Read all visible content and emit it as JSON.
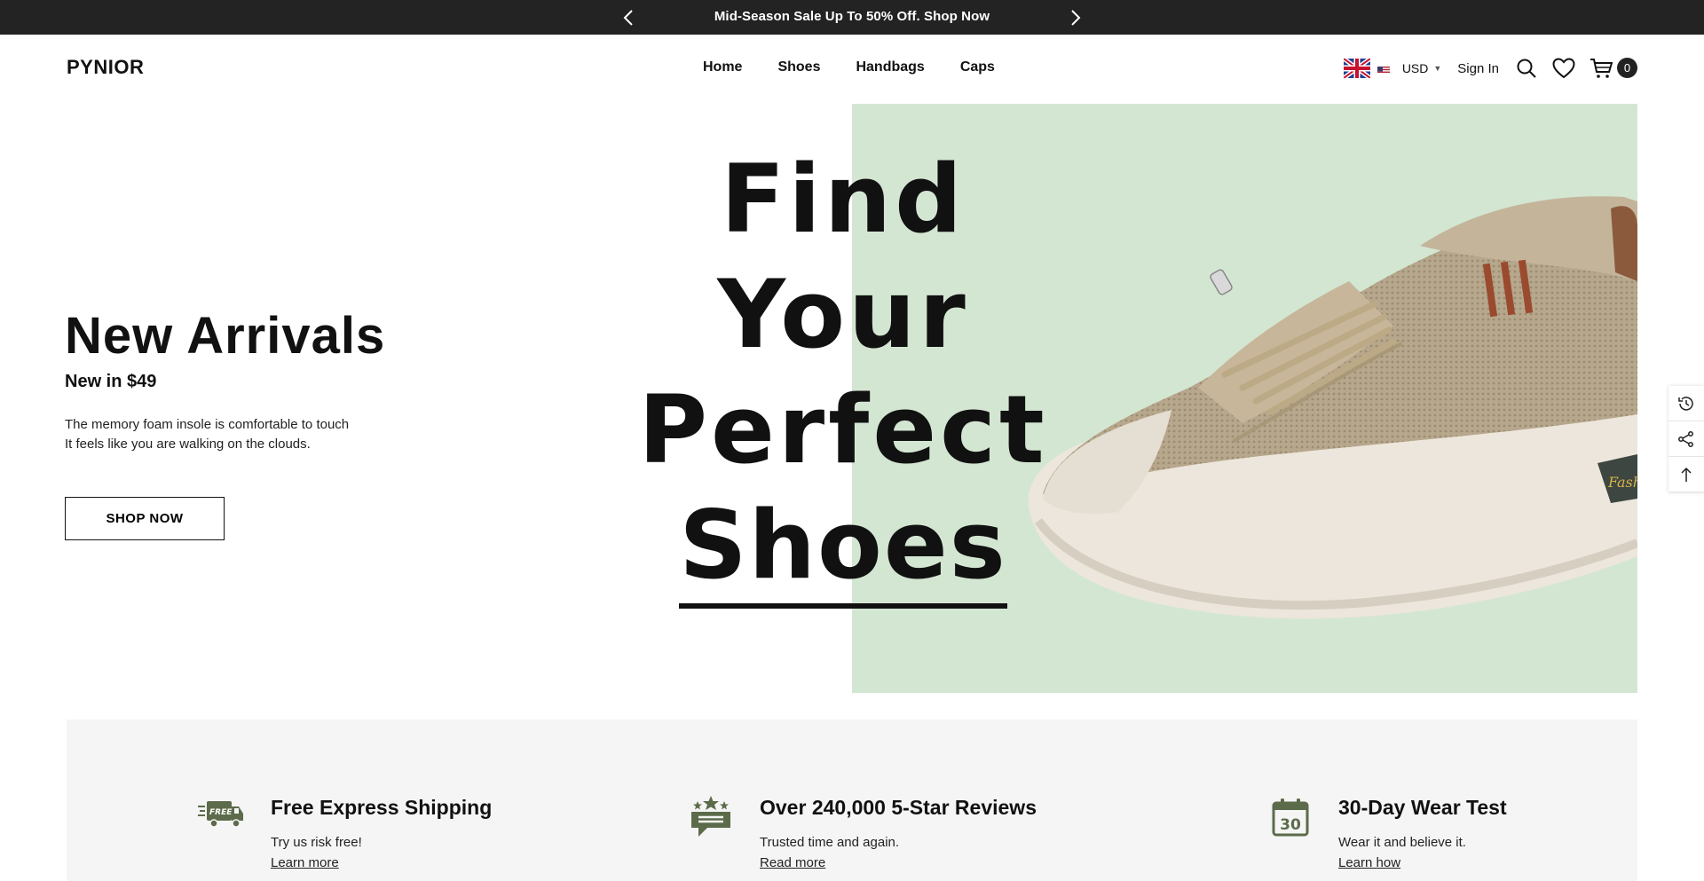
{
  "announcement": {
    "message": "Mid-Season Sale Up To 50% Off. Shop Now"
  },
  "header": {
    "logo": "PYNIOR",
    "nav": [
      "Home",
      "Shoes",
      "Handbags",
      "Caps"
    ],
    "currency": "USD",
    "sign_in": "Sign In",
    "cart_count": "0"
  },
  "hero": {
    "headline": [
      "Find Your",
      "Perfect",
      "Shoes"
    ],
    "title": "New Arrivals",
    "subtitle": "New in $49",
    "description": [
      "The memory foam insole is comfortable to touch",
      "It feels like you are walking on the clouds."
    ],
    "button": "SHOP NOW",
    "shoe_badge": "Fashion"
  },
  "features": [
    {
      "icon": "free-shipping-truck-icon",
      "title": "Free Express Shipping",
      "text": "Try us risk free!",
      "link": "Learn more",
      "icon_badge": "FREE"
    },
    {
      "icon": "star-reviews-icon",
      "title": "Over 240,000 5-Star Reviews",
      "text": "Trusted time and again.",
      "link": "Read more"
    },
    {
      "icon": "calendar-30-icon",
      "title": "30-Day Wear Test",
      "text": "Wear it and believe it.",
      "link": "Learn how",
      "icon_badge": "30"
    }
  ],
  "colors": {
    "announce_bg": "#232323",
    "hero_bg": "#d3e6d2",
    "feature_bg": "#f5f5f5",
    "icon_green": "#5c6b4a"
  }
}
